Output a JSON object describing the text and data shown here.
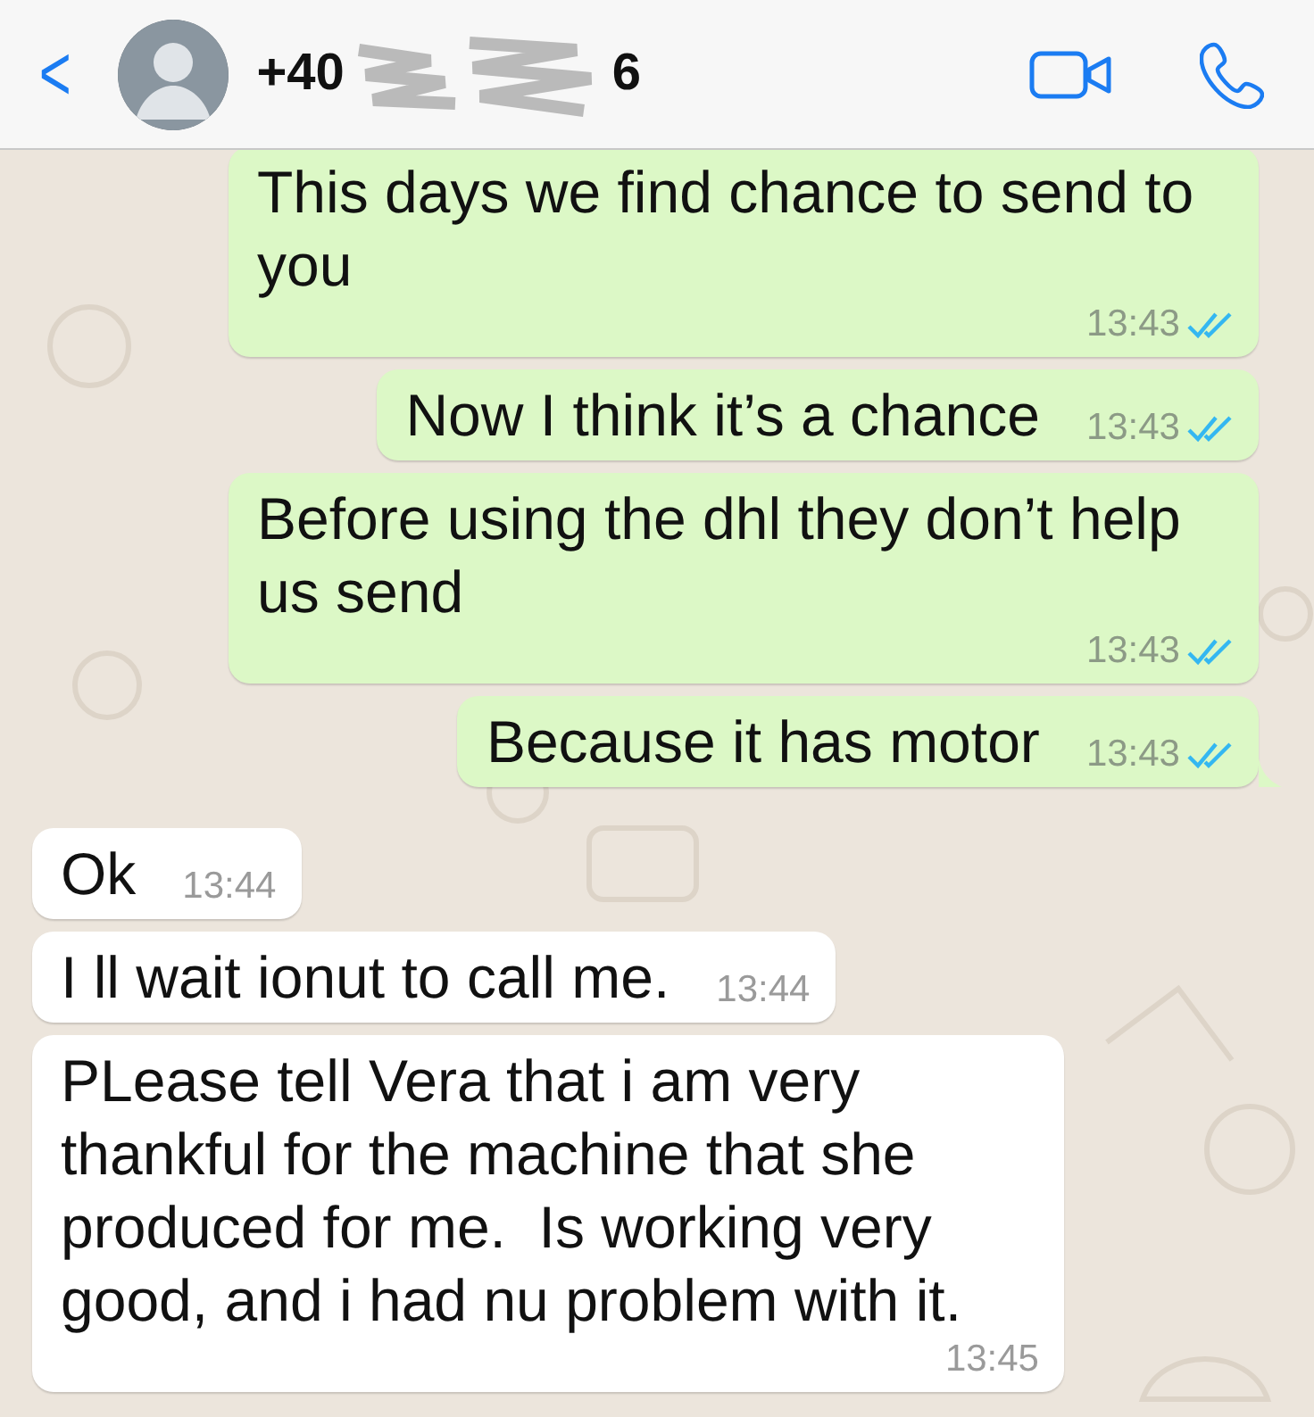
{
  "header": {
    "back": "<",
    "contact": "+40",
    "contact_tail": "6"
  },
  "messages": [
    {
      "kind": "sent",
      "text": "This days we find chance to send to you",
      "time": "13:43",
      "read": true
    },
    {
      "kind": "sent",
      "text": "Now I think it’s a chance",
      "time": "13:43",
      "read": true
    },
    {
      "kind": "sent",
      "text": "Before using the dhl they don’t help us send",
      "time": "13:43",
      "read": true
    },
    {
      "kind": "sent",
      "text": "Because it has motor",
      "time": "13:43",
      "read": true,
      "tail": true
    },
    {
      "kind": "received",
      "text": "Ok",
      "time": "13:44"
    },
    {
      "kind": "received",
      "text": "I ll wait ionut to call me.",
      "time": "13:44"
    },
    {
      "kind": "received",
      "text": "PLease tell Vera that i am very thankful for the machine that she produced for me.  Is working very good, and i had nu problem with it.",
      "time": "13:45"
    }
  ]
}
